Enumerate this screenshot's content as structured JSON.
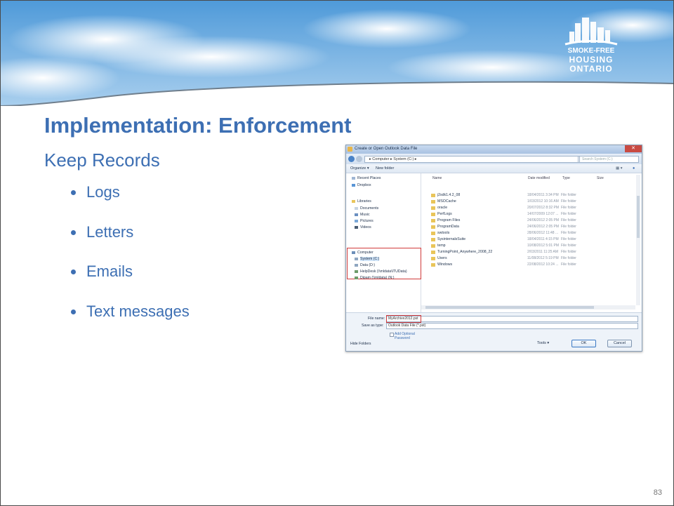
{
  "slide": {
    "title": "Implementation:  Enforcement",
    "subtitle": "Keep Records",
    "bullets": [
      "Logs",
      "Letters",
      "Emails",
      "Text messages"
    ],
    "page_number": "83",
    "logo_lines": [
      "SMOKE-FREE",
      "HOUSING",
      "ONTARIO"
    ]
  },
  "dialog": {
    "title": "Create or Open Outlook Data File",
    "address_path": "▸ Computer ▸ System (C:) ▸",
    "search_placeholder": "Search System (C:)",
    "toolbar": {
      "organize": "Organize ▾",
      "new_folder": "New folder"
    },
    "tree": {
      "recent_places": "Recent Places",
      "dropbox": "Dropbox",
      "libraries": "Libraries",
      "documents": "Documents",
      "music": "Music",
      "pictures": "Pictures",
      "videos": "Videos",
      "computer": "Computer",
      "system_c": "System (C:)",
      "data_d": "Data (D:)",
      "helpdesk": "HelpDesk (\\\\mldata\\ITUData)",
      "dipam": "Dipam (\\\\mldata) (N:)"
    },
    "columns": {
      "name": "Name",
      "date_modified": "Date modified",
      "type": "Type",
      "size": "Size"
    },
    "files": [
      {
        "name": "j2sdk1.4.2_08",
        "date": "18/04/2011 3:34 PM",
        "type": "File folder"
      },
      {
        "name": "MSOCache",
        "date": "1/03/2012 10:16 AM",
        "type": "File folder"
      },
      {
        "name": "oracle",
        "date": "20/07/2012 8:32 PM",
        "type": "File folder"
      },
      {
        "name": "PerfLogs",
        "date": "14/07/2009 12:07 ...",
        "type": "File folder"
      },
      {
        "name": "Program Files",
        "date": "24/06/2012 2:05 PM",
        "type": "File folder"
      },
      {
        "name": "ProgramData",
        "date": "24/06/2012 2:05 PM",
        "type": "File folder"
      },
      {
        "name": "swtools",
        "date": "28/06/2012 11:48 ...",
        "type": "File folder"
      },
      {
        "name": "SysinternalsSuite",
        "date": "18/04/2011 4:15 PM",
        "type": "File folder"
      },
      {
        "name": "temp",
        "date": "10/08/2012 5:01 PM",
        "type": "File folder"
      },
      {
        "name": "TurningPoint_Anywhere_2008_22",
        "date": "2/03/2011 11:25 AM",
        "type": "File folder"
      },
      {
        "name": "Users",
        "date": "11/08/2012 5:19 PM",
        "type": "File folder"
      },
      {
        "name": "Windows",
        "date": "22/08/2012 10:24 ...",
        "type": "File folder"
      }
    ],
    "file_name_label": "File name:",
    "file_name_value": "MyArchive2012.pst",
    "save_type_label": "Save as type:",
    "save_type_value": "Outlook Data File (*.pst)",
    "add_optional_password": "Add Optional Password",
    "hide_folders": "Hide Folders",
    "tools": "Tools ▾",
    "ok": "OK",
    "cancel": "Cancel"
  },
  "colors": {
    "accent": "#3d6fb3",
    "highlight": "#d13a3a"
  }
}
